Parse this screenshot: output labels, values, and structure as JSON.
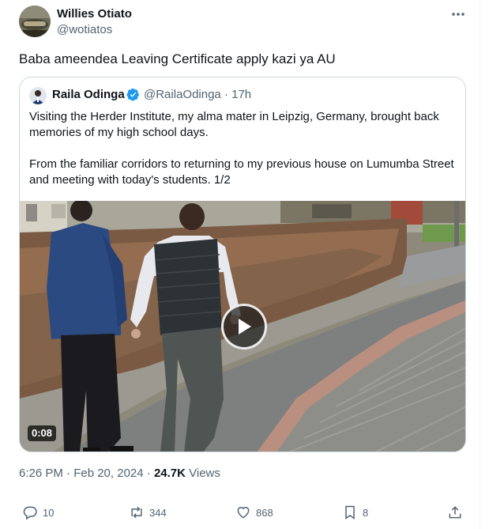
{
  "author": {
    "name": "Willies Otiato",
    "handle": "@wotiatos"
  },
  "tweet": {
    "text": "Baba ameendea Leaving Certificate apply kazi ya AU"
  },
  "quoted": {
    "name": "Raila Odinga",
    "handle_time": "@RailaOdinga · 17h",
    "verified": true,
    "paragraph1": "Visiting the Herder Institute, my alma mater in Leipzig, Germany, brought back memories of my high school days.",
    "paragraph2": "From the familiar corridors to returning to my previous house on Lumumba Street and meeting with today's students. 1/2",
    "video": {
      "duration": "0:08"
    }
  },
  "meta": {
    "time_date": "6:26 PM · Feb 20, 2024 · ",
    "views_count": "24.7K",
    "views_label": " Views"
  },
  "actions": {
    "replies": "10",
    "reposts": "344",
    "likes": "868",
    "bookmarks": "8"
  },
  "icons": {
    "more": "more-icon",
    "verified": "verified-badge-icon",
    "play": "play-icon",
    "reply": "reply-icon",
    "repost": "repost-icon",
    "like": "like-icon",
    "bookmark": "bookmark-icon",
    "share": "share-icon"
  },
  "colors": {
    "verified": "#1d9bf0",
    "text": "#0f1419",
    "secondary": "#536471",
    "border": "#cfd9de"
  }
}
